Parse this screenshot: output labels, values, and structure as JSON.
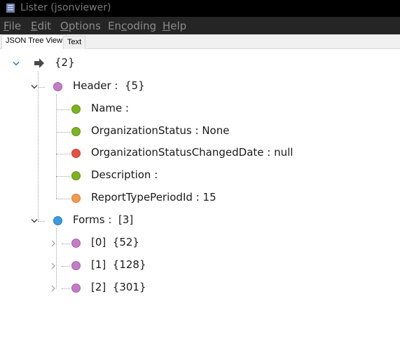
{
  "window": {
    "title": "Lister (jsonviewer)"
  },
  "menu": {
    "items": [
      {
        "accel": "F",
        "rest": "ile"
      },
      {
        "accel": "E",
        "rest": "dit"
      },
      {
        "accel": "O",
        "rest": "ptions"
      },
      {
        "pre": "En",
        "accel": "c",
        "rest": "oding"
      },
      {
        "accel": "H",
        "rest": "elp"
      }
    ]
  },
  "tabs": [
    {
      "label": "JSON Tree View",
      "active": true
    },
    {
      "label": "Text",
      "active": false
    }
  ],
  "tree": {
    "root": {
      "label": "{2}",
      "icon": "arrow-right-icon",
      "expanded": true
    },
    "header": {
      "key": "Header",
      "sep": ":",
      "value": "{5}",
      "color": "#c47cc6",
      "expanded": true,
      "children": [
        {
          "key": "Name",
          "sep": ":",
          "value": "",
          "color": "#7ab51d"
        },
        {
          "key": "OrganizationStatus",
          "sep": ":",
          "value": "None",
          "color": "#7ab51d"
        },
        {
          "key": "OrganizationStatusChangedDate",
          "sep": ":",
          "value": "null",
          "color": "#e8503e"
        },
        {
          "key": "Description",
          "sep": ":",
          "value": "",
          "color": "#7ab51d"
        },
        {
          "key": "ReportTypePeriodId",
          "sep": ":",
          "value": "15",
          "color": "#f39a4a"
        }
      ]
    },
    "forms": {
      "key": "Forms",
      "sep": ":",
      "value": "[3]",
      "color": "#3d9ae0",
      "expanded": true,
      "children": [
        {
          "key": "[0]",
          "value": "{52}",
          "color": "#c47cc6",
          "expanded": false
        },
        {
          "key": "[1]",
          "value": "{128}",
          "color": "#c47cc6",
          "expanded": false
        },
        {
          "key": "[2]",
          "value": "{301}",
          "color": "#c47cc6",
          "expanded": false
        }
      ]
    }
  }
}
